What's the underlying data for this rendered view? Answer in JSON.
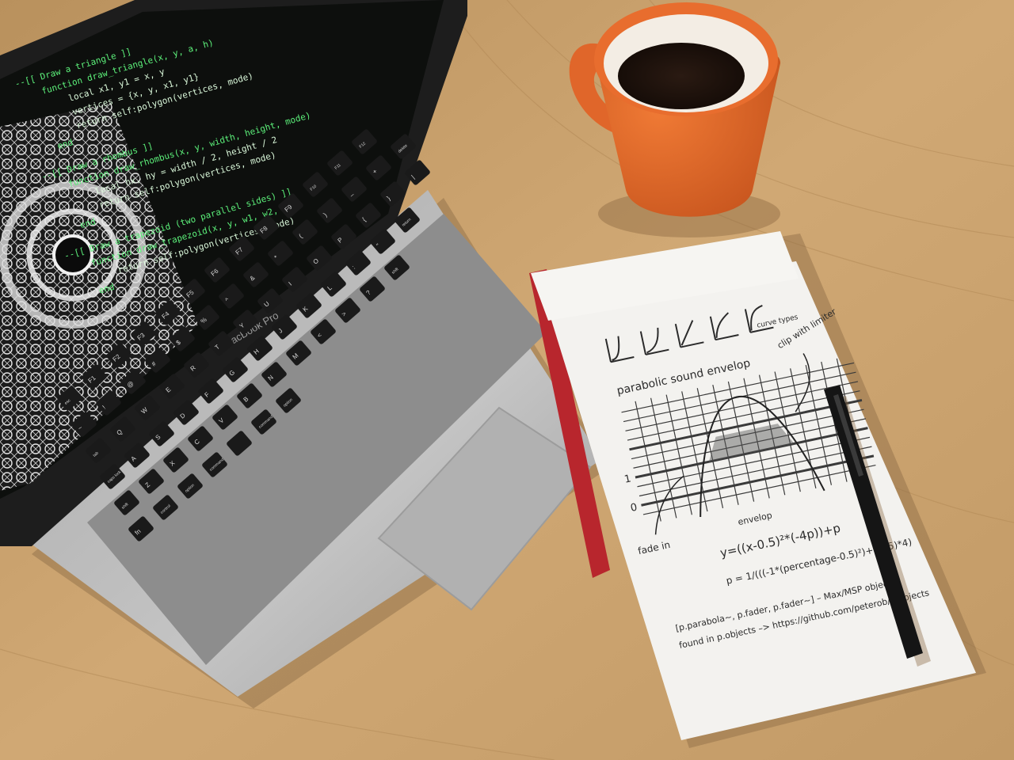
{
  "laptop": {
    "brand_label": "MacBook Pro",
    "keyboard": {
      "row1": [
        "esc",
        "F1",
        "F2",
        "F3",
        "F4",
        "F5",
        "F6",
        "F7",
        "F8",
        "F9",
        "F10",
        "F11",
        "F12"
      ],
      "row2": [
        "~",
        "!",
        "@",
        "#",
        "$",
        "%",
        "^",
        "&",
        "*",
        "(",
        ")",
        "_",
        "+",
        "delete"
      ],
      "row3": [
        "tab",
        "Q",
        "W",
        "E",
        "R",
        "T",
        "Y",
        "U",
        "I",
        "O",
        "P",
        "{",
        "}",
        "|"
      ],
      "row4": [
        "caps lock",
        "A",
        "S",
        "D",
        "F",
        "G",
        "H",
        "J",
        "K",
        "L",
        ":",
        "\"",
        "return"
      ],
      "row5": [
        "shift",
        "Z",
        "X",
        "C",
        "V",
        "B",
        "N",
        "M",
        "<",
        ">",
        "?",
        "shift"
      ],
      "row6": [
        "fn",
        "control",
        "option",
        "command",
        "",
        "command",
        "option"
      ]
    },
    "code_lines": [
      "--[[ Draw a triangle ]]",
      "function draw_triangle(x, y, a, h)",
      "  local x1, y1 = x, y",
      "  vertices = {x, y, x1, y1}",
      "  return self:polygon(vertices, mode)",
      "end",
      "--[[ Draw a rhombus ]]",
      "function draw_rhombus(x, y, width, height, mode)",
      "  local hx, hy = width / 2, height / 2",
      "  return self:polygon(vertices, mode)",
      "end",
      "--[[ Draw a trapezoid (two parallel sides) ]]",
      "function draw_trapezoid(x, y, w1, w2, h)",
      "  return self:polygon(vertices, mode)",
      "end"
    ]
  },
  "notepad": {
    "curve_types_label": "curve types",
    "sketch_title": "parabolic sound envelop",
    "clip_note": "clip with limiter",
    "axis_one": "1",
    "axis_zero": "0",
    "fade_in": "fade in",
    "envelope_label": "envelop",
    "formula1": "y=((x-0.5)²*(-4p))+p",
    "formula2": "p = 1/(((-1*(percentage-0.5)²)+0.25)*4)",
    "footer_line1": "[p.parabola~, p.fader, p.fader~] – Max/MSP objects",
    "footer_line2": "found in p.objects –> https://github.com/peterob/p.objects"
  },
  "colors": {
    "desk": "#c9a36e",
    "mug": "#e0662a",
    "code_green": "#5cf07a",
    "laptop_body": "#b9b9b9"
  }
}
